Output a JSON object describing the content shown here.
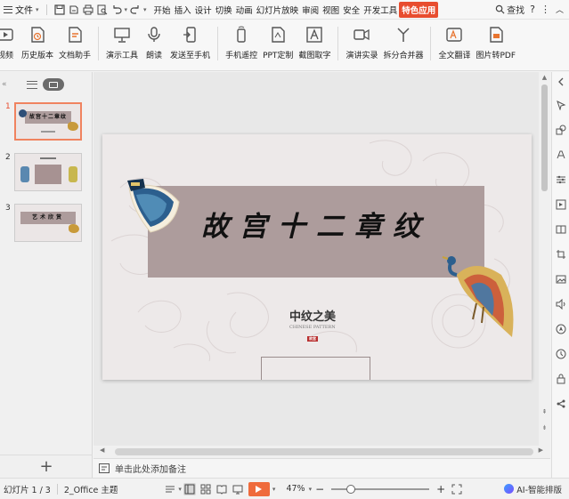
{
  "menubar": {
    "file_label": "文件",
    "tabs": [
      "开始",
      "插入",
      "设计",
      "切换",
      "动画",
      "幻灯片放映",
      "审阅",
      "视图",
      "安全",
      "开发工具"
    ],
    "special_tab": "特色应用",
    "search_label": "查找"
  },
  "ribbon": {
    "buttons": [
      {
        "label": "视频",
        "icon": "video-icon"
      },
      {
        "label": "历史版本",
        "icon": "history-icon"
      },
      {
        "label": "文档助手",
        "icon": "doc-assistant-icon"
      },
      {
        "label": "演示工具",
        "icon": "presentation-tools-icon"
      },
      {
        "label": "朗读",
        "icon": "microphone-icon"
      },
      {
        "label": "发送至手机",
        "icon": "send-to-phone-icon"
      },
      {
        "label": "手机遥控",
        "icon": "phone-remote-icon"
      },
      {
        "label": "PPT定制",
        "icon": "ppt-custom-icon"
      },
      {
        "label": "截图取字",
        "icon": "ocr-icon"
      },
      {
        "label": "演讲实录",
        "icon": "camera-record-icon"
      },
      {
        "label": "拆分合并器",
        "icon": "split-merge-icon"
      },
      {
        "label": "全文翻译",
        "icon": "translate-icon"
      },
      {
        "label": "图片转PDF",
        "icon": "image-to-pdf-icon"
      }
    ]
  },
  "slides_panel": {
    "thumbnails": [
      {
        "number": "1",
        "title": "故宫十二章纹",
        "active": true
      },
      {
        "number": "2",
        "title": "",
        "active": false
      },
      {
        "number": "3",
        "title": "艺术欣赏",
        "active": false
      }
    ],
    "add_label": "+"
  },
  "slide": {
    "title": "故宫十二章纹",
    "brand": "中纹之美",
    "brand_sub": "CHINESE PATTERN",
    "seal": "故宫"
  },
  "notes": {
    "placeholder": "单击此处添加备注"
  },
  "statusbar": {
    "slide_counter": "幻灯片 1 / 3",
    "theme": "2_Office 主题",
    "zoom": "47%",
    "zoom_fraction": 0.2,
    "ai_label": "AI-智能排版"
  },
  "colors": {
    "accent": "#e84d2f",
    "title_band": "#ad9c9c",
    "slide_bg": "#ede9e9"
  }
}
